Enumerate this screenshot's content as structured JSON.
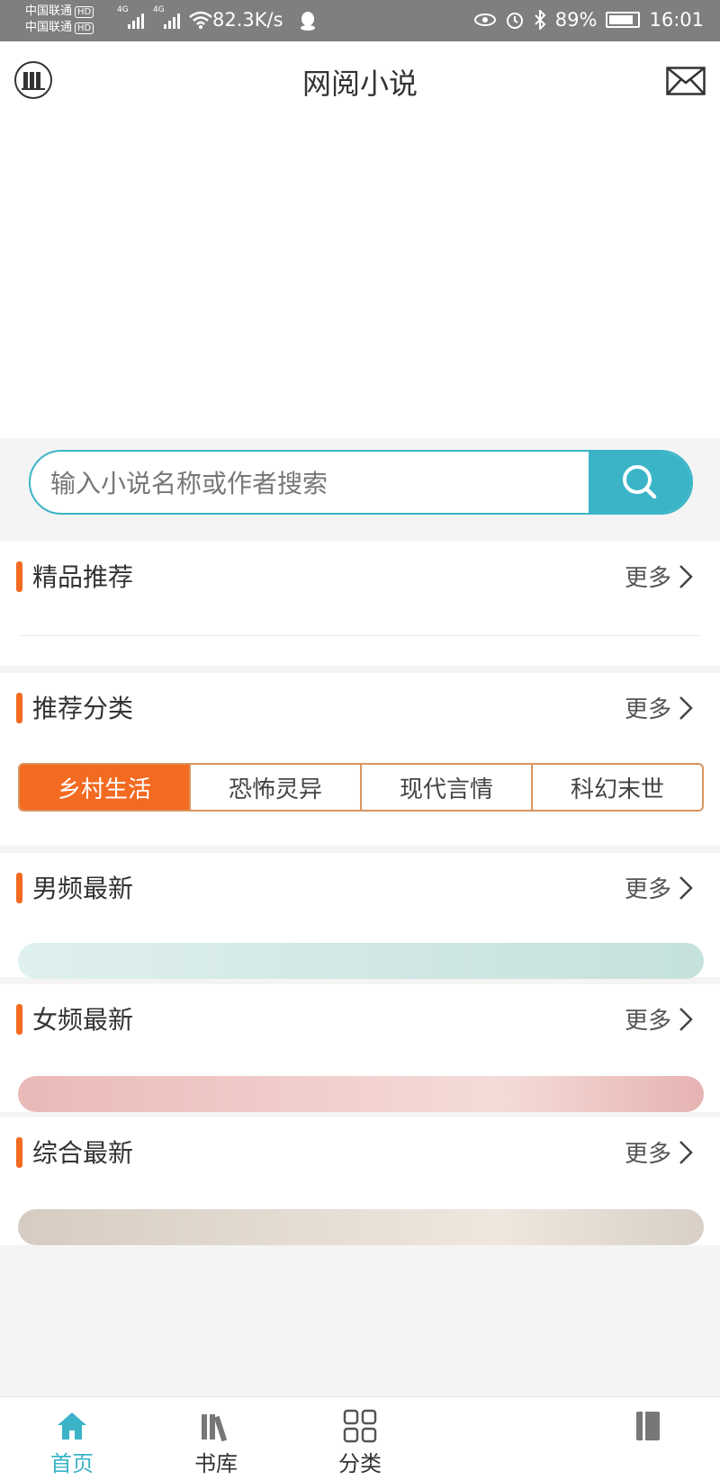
{
  "status_bar": {
    "carrier_1": "中国联通",
    "carrier_2": "中国联通",
    "hd_label": "HD",
    "net_label": "4G",
    "speed": "82.3K/s",
    "battery": "89%",
    "time": "16:01"
  },
  "header": {
    "title": "网阅小说",
    "logo_icon": "bookshelf-icon",
    "mail_icon": "mail-icon"
  },
  "search": {
    "placeholder": "输入小说名称或作者搜索",
    "button_icon": "search-icon"
  },
  "sections": {
    "featured": {
      "title": "精品推荐",
      "more": "更多"
    },
    "categories": {
      "title": "推荐分类",
      "more": "更多",
      "tabs": [
        {
          "label": "乡村生活",
          "active": true
        },
        {
          "label": "恐怖灵异",
          "active": false
        },
        {
          "label": "现代言情",
          "active": false
        },
        {
          "label": "科幻末世",
          "active": false
        }
      ]
    },
    "male_latest": {
      "title": "男频最新",
      "more": "更多"
    },
    "female_latest": {
      "title": "女频最新",
      "more": "更多"
    },
    "general_latest": {
      "title": "综合最新",
      "more": "更多"
    }
  },
  "bottom_nav": [
    {
      "label": "首页",
      "icon": "home-icon",
      "active": true
    },
    {
      "label": "书库",
      "icon": "library-icon",
      "active": false
    },
    {
      "label": "分类",
      "icon": "grid-icon",
      "active": false
    },
    {
      "label": "",
      "icon": "book-icon",
      "active": false
    }
  ],
  "colors": {
    "accent": "#3bb4c7",
    "orange": "#f36a21",
    "tab_border": "#d9955e"
  }
}
